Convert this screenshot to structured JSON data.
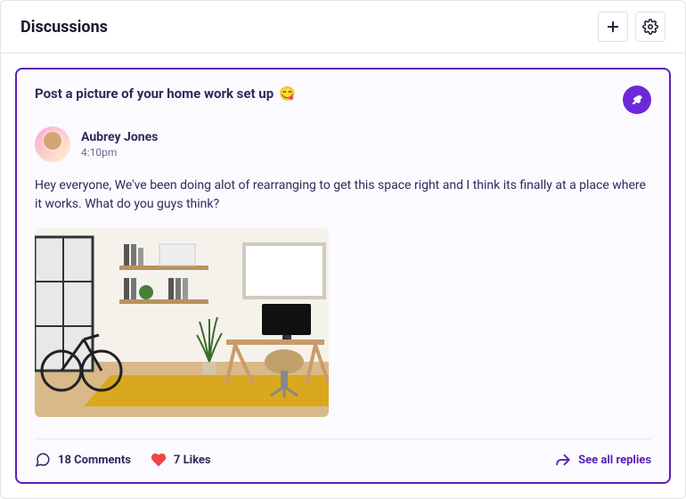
{
  "header": {
    "title": "Discussions"
  },
  "post": {
    "title": "Post a picture of your home work set up",
    "emoji": "😋",
    "author_name": "Aubrey Jones",
    "time": "4:10pm",
    "body": "Hey everyone, We've been doing alot of rearranging to get this space right and I think its finally at a place where it works. What do you guys think?",
    "comments_label": "18 Comments",
    "likes_label": "7 Likes",
    "see_replies_label": "See all replies"
  }
}
